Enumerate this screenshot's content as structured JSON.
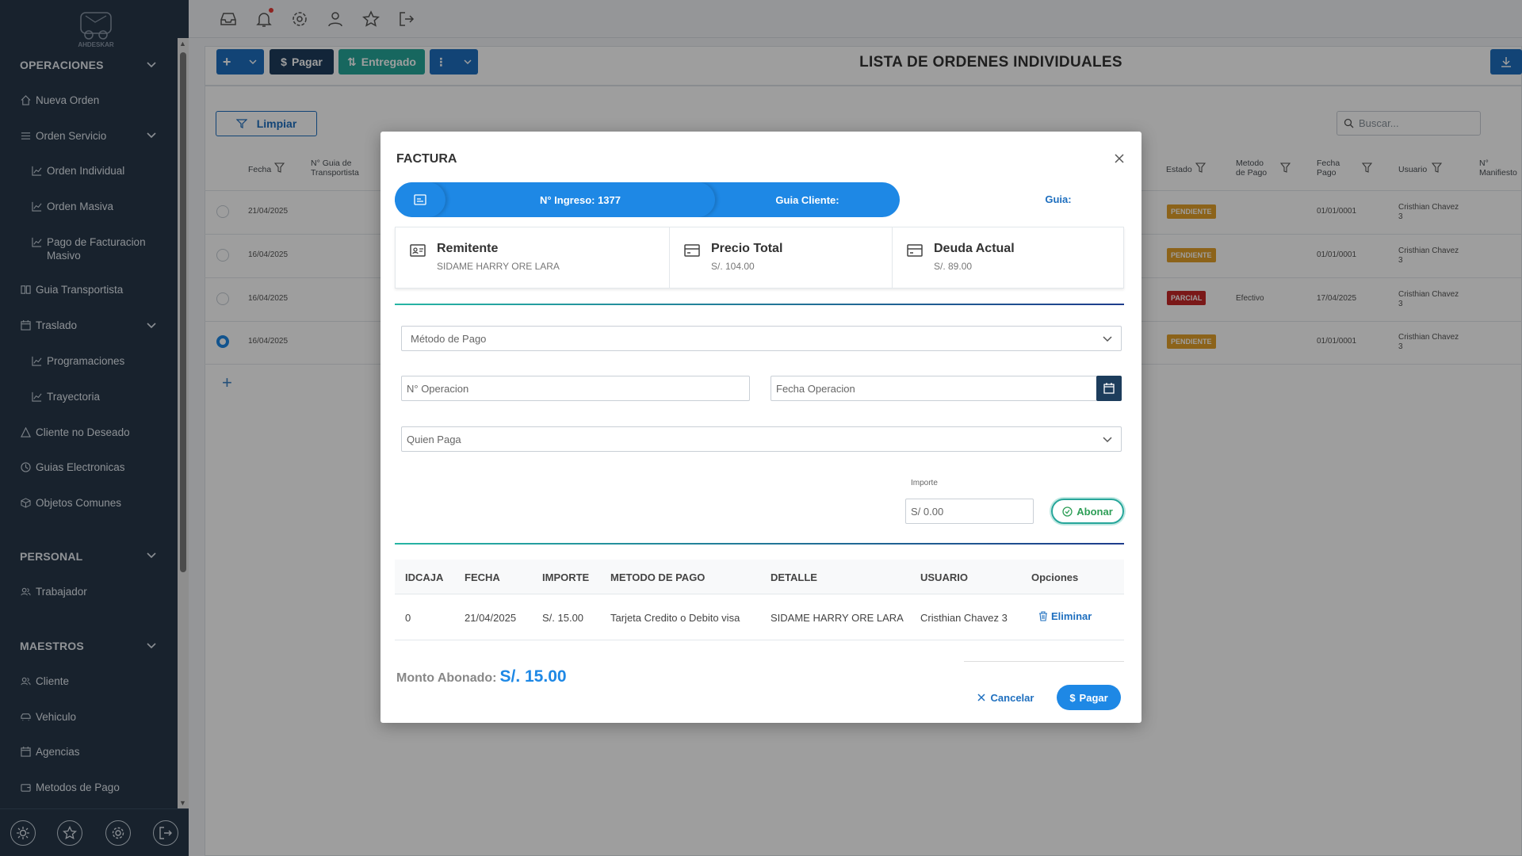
{
  "sidebar": {
    "logo_text": "AHDESKAR",
    "sections": [
      {
        "label": "OPERACIONES"
      },
      {
        "label": "PERSONAL"
      },
      {
        "label": "MAESTROS"
      }
    ],
    "items": [
      {
        "label": "Nueva Orden",
        "icon": "home-icon"
      },
      {
        "label": "Orden Servicio",
        "icon": "list-icon"
      },
      {
        "label": "Orden Individual",
        "icon": "chart-line-icon"
      },
      {
        "label": "Orden Masiva",
        "icon": "chart-line-icon"
      },
      {
        "label": "Pago de Facturacion Masivo",
        "icon": "chart-line-icon"
      },
      {
        "label": "Guia Transportista",
        "icon": "book-icon"
      },
      {
        "label": "Traslado",
        "icon": "calendar-icon"
      },
      {
        "label": "Programaciones",
        "icon": "chart-line-icon"
      },
      {
        "label": "Trayectoria",
        "icon": "chart-line-icon"
      },
      {
        "label": "Cliente no Deseado",
        "icon": "warning-icon"
      },
      {
        "label": "Guias Electronicas",
        "icon": "clock-icon"
      },
      {
        "label": "Objetos Comunes",
        "icon": "box-icon"
      },
      {
        "label": "Trabajador",
        "icon": "users-icon"
      },
      {
        "label": "Cliente",
        "icon": "users-icon"
      },
      {
        "label": "Vehiculo",
        "icon": "car-icon"
      },
      {
        "label": "Agencias",
        "icon": "calendar-icon"
      },
      {
        "label": "Metodos de Pago",
        "icon": "wallet-icon"
      }
    ]
  },
  "toolbar": {
    "pagar_label": "Pagar",
    "entregado_label": "Entregado",
    "page_title": "LISTA DE ORDENES INDIVIDUALES",
    "limpiar_label": "Limpiar",
    "search_placeholder": "Buscar..."
  },
  "table": {
    "headers": {
      "fecha": "Fecha",
      "guia": "N° Guia de Transportista",
      "estado": "Estado",
      "metodo": "Metodo de Pago",
      "fecha_pago": "Fecha Pago",
      "usuario": "Usuario",
      "manifiesto": "N° Manifiesto"
    },
    "rows": [
      {
        "fecha": "21/04/2025",
        "estado": "PENDIENTE",
        "metodo": "",
        "fecha_pago": "01/01/0001",
        "usuario": "Cristhian Chavez 3"
      },
      {
        "fecha": "16/04/2025",
        "estado": "PENDIENTE",
        "metodo": "",
        "fecha_pago": "01/01/0001",
        "usuario": "Cristhian Chavez 3"
      },
      {
        "fecha": "16/04/2025",
        "estado": "PARCIAL",
        "metodo": "Efectivo",
        "fecha_pago": "17/04/2025",
        "usuario": "Cristhian Chavez 3"
      },
      {
        "fecha": "16/04/2025",
        "estado": "PENDIENTE",
        "metodo": "",
        "fecha_pago": "01/01/0001",
        "usuario": "Cristhian Chavez 3"
      }
    ],
    "colors": {
      "pendiente": "#e2a12b",
      "parcial": "#c62828"
    }
  },
  "modal": {
    "title": "FACTURA",
    "steps": {
      "ingreso": "N° Ingreso: 1377",
      "guia_cliente": "Guia Cliente:",
      "guia": "Guia:"
    },
    "cards": [
      {
        "title": "Remitente",
        "value": "SIDAME HARRY ORE LARA",
        "icon": "id-card-icon"
      },
      {
        "title": "Precio Total",
        "value": "S/. 104.00",
        "icon": "credit-card-icon"
      },
      {
        "title": "Deuda Actual",
        "value": "S/. 89.00",
        "icon": "credit-card-icon"
      }
    ],
    "form": {
      "metodo_pago": "Método de Pago",
      "n_operacion": "N° Operacion",
      "fecha_operacion": "Fecha Operacion",
      "quien_paga": "Quien Paga",
      "importe_label": "Importe",
      "importe_value": "S/ 0.00",
      "abonar_label": "Abonar"
    },
    "payments": {
      "headers": [
        "IDCAJA",
        "FECHA",
        "IMPORTE",
        "METODO DE PAGO",
        "DETALLE",
        "USUARIO",
        "Opciones"
      ],
      "rows": [
        {
          "idcaja": "0",
          "fecha": "21/04/2025",
          "importe": "S/. 15.00",
          "metodo": "Tarjeta Credito o Debito visa",
          "detalle": "SIDAME HARRY ORE LARA",
          "usuario": "Cristhian Chavez 3",
          "opcion": "Eliminar"
        }
      ]
    },
    "monto_label": "Monto Abonado:",
    "monto_value": "S/. 15.00",
    "cancel_label": "Cancelar",
    "pay_label": "Pagar",
    "accent": "#1e88e5"
  }
}
